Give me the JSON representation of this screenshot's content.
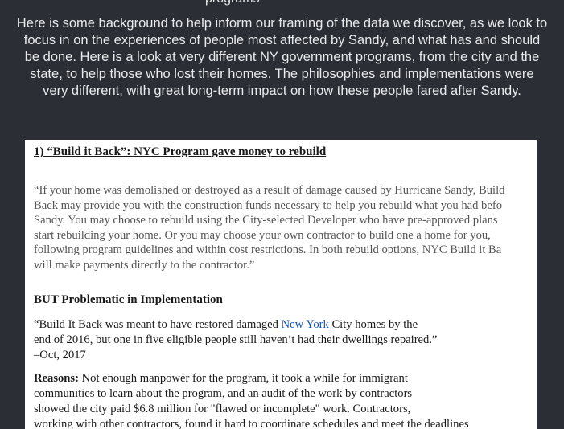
{
  "top_cut_text": "programs",
  "intro_text": "Here is some background to help inform our framing of the data we discover, as we look to focus in on the experiences of people most affected by Sandy, and what has and should be done. Here is a look at very different NY government programs, from the city and the state, to help those who lost their homes. The philosophies and implementations were very different, with great long-term impact on how these people fared after Sandy.",
  "doc": {
    "heading1": "1) “Build it Back”: NYC Program gave money to rebuild",
    "quote_lines": [
      "“If your home was demolished or destroyed as a result of damage caused by Hurricane Sandy, Build",
      "Back may provide you with the construction funds necessary to help you rebuild what you had befo",
      "Sandy.  You may choose to rebuild using the City-selected Developer who have pre-approved plans",
      "start rebuilding your home. Or you may choose your own contractor to build one a home for you,",
      "following program guidelines and within cost restrictions. In both rebuild options, NYC Build it Ba",
      "will make payments directly to the contractor.”"
    ],
    "heading2": "BUT Problematic in Implementation",
    "q2_line1_before": " “Build It Back was meant to have restored damaged ",
    "q2_link": "New York",
    "q2_line1_after": " City homes by the",
    "q2_line2": "end of 2016, but one in five eligible people still haven’t had their dwellings repaired.”",
    "q2_line3": "–Oct, 2017",
    "reasons_label": "Reasons:",
    "reasons_line1": " Not enough manpower for the program, it took a while for immigrant",
    "reasons_line2": "communities to learn about the program, and an audit of the work by contractors",
    "reasons_line3": "showed the city paid $6.8 million for \"flawed or incomplete\" work. Contractors,",
    "reasons_line4": "working with other contractors, found it hard to coordinate schedules and meet the deadlines"
  }
}
